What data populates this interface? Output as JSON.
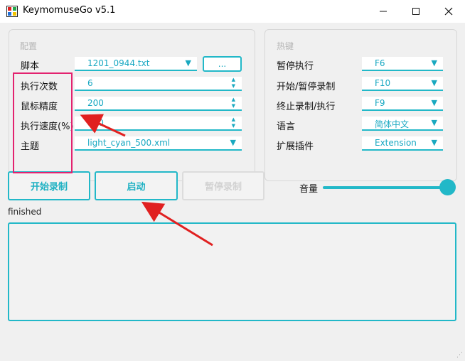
{
  "window": {
    "title": "KeymomuseGo v5.1",
    "minimize_icon": "minimize-icon",
    "maximize_icon": "maximize-icon",
    "close_icon": "close-icon"
  },
  "config": {
    "group_title": "配置",
    "script_label": "脚本",
    "script_value": "1201_0944.txt",
    "browse_label": "...",
    "run_times_label": "执行次数",
    "run_times_value": "6",
    "precision_label": "鼠标精度",
    "precision_value": "200",
    "speed_label": "执行速度(%)",
    "speed_value": "100",
    "theme_label": "主题",
    "theme_value": "light_cyan_500.xml"
  },
  "hotkeys": {
    "group_title": "热键",
    "pause_label": "暂停执行",
    "pause_value": "F6",
    "record_label": "开始/暂停录制",
    "record_value": "F10",
    "stop_label": "终止录制/执行",
    "stop_value": "F9",
    "language_label": "语言",
    "language_value": "简体中文",
    "plugin_label": "扩展插件",
    "plugin_value": "Extension"
  },
  "buttons": {
    "start_record": "开始录制",
    "launch": "启动",
    "pause_record": "暂停录制"
  },
  "volume": {
    "label": "音量",
    "level_percent": 100
  },
  "status_text": "finished",
  "colors": {
    "accent": "#22b8c8",
    "highlight": "#e3226f",
    "annotation_arrow": "#e02020"
  }
}
